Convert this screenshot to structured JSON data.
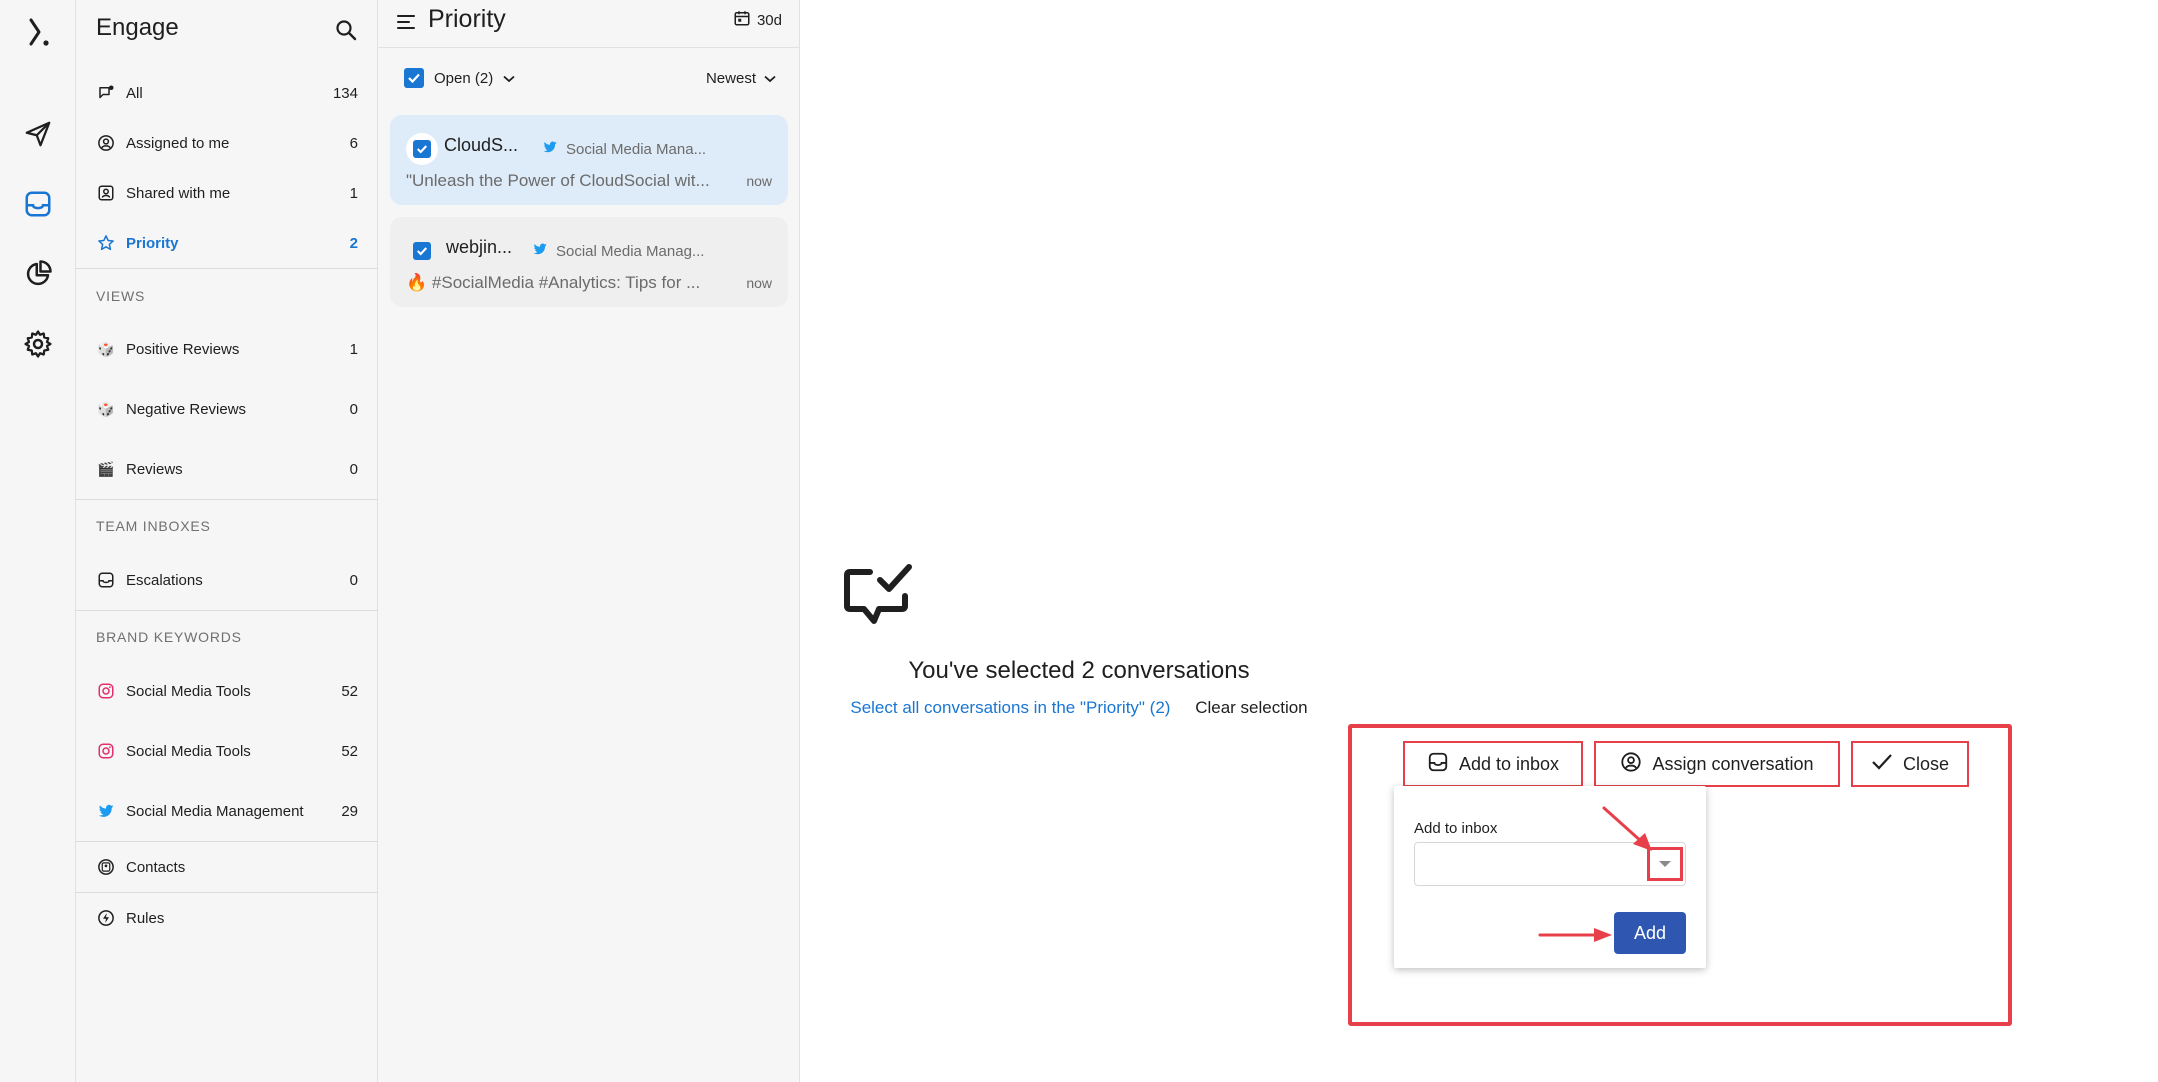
{
  "sidebar": {
    "title": "Engage",
    "items": [
      {
        "label": "All",
        "count": "134"
      },
      {
        "label": "Assigned to me",
        "count": "6"
      },
      {
        "label": "Shared with me",
        "count": "1"
      },
      {
        "label": "Priority",
        "count": "2"
      }
    ],
    "views_header": "VIEWS",
    "views": [
      {
        "label": "Positive Reviews",
        "count": "1"
      },
      {
        "label": "Negative Reviews",
        "count": "0"
      },
      {
        "label": "Reviews",
        "count": "0"
      }
    ],
    "team_header": "TEAM INBOXES",
    "team": [
      {
        "label": "Escalations",
        "count": "0"
      }
    ],
    "brand_header": "BRAND KEYWORDS",
    "brand": [
      {
        "label": "Social Media Tools",
        "count": "52"
      },
      {
        "label": "Social Media Tools",
        "count": "52"
      },
      {
        "label": "Social Media Management",
        "count": "29"
      }
    ],
    "contacts": "Contacts",
    "rules": "Rules"
  },
  "list": {
    "title": "Priority",
    "range": "30d",
    "filter": "Open (2)",
    "sort": "Newest",
    "conversations": [
      {
        "name": "CloudS...",
        "source": "Social Media Mana...",
        "message": "\"Unleash the Power of CloudSocial wit...",
        "time": "now"
      },
      {
        "name": "webjin...",
        "source": "Social Media Manag...",
        "message": "#SocialMedia #Analytics: Tips for ...",
        "time": "now"
      }
    ]
  },
  "main": {
    "title": "You've selected 2 conversations",
    "select_all": "Select all conversations in the \"Priority\" (2)",
    "clear": "Clear selection",
    "actions": {
      "add_to_inbox": "Add to inbox",
      "assign": "Assign conversation",
      "close": "Close"
    },
    "popup": {
      "label": "Add to inbox",
      "value": "",
      "add": "Add"
    }
  },
  "colors": {
    "accent": "#1976d2",
    "annotation": "#e8404a",
    "primary_button": "#2f56b0"
  }
}
